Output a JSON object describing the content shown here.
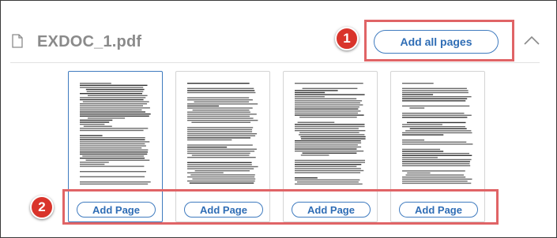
{
  "file": {
    "name": "EXDOC_1.pdf",
    "icon": "file-icon"
  },
  "toolbar": {
    "add_all_label": "Add all pages",
    "collapse_icon": "chevron-up-icon"
  },
  "callouts": [
    {
      "number": "1"
    },
    {
      "number": "2"
    }
  ],
  "pages": [
    {
      "add_label": "Add Page",
      "selected": true
    },
    {
      "add_label": "Add Page",
      "selected": false
    },
    {
      "add_label": "Add Page",
      "selected": false
    },
    {
      "add_label": "Add Page",
      "selected": false
    }
  ],
  "colors": {
    "accent": "#2f6db5",
    "callout": "#e06466",
    "badge": "#d9342b"
  }
}
